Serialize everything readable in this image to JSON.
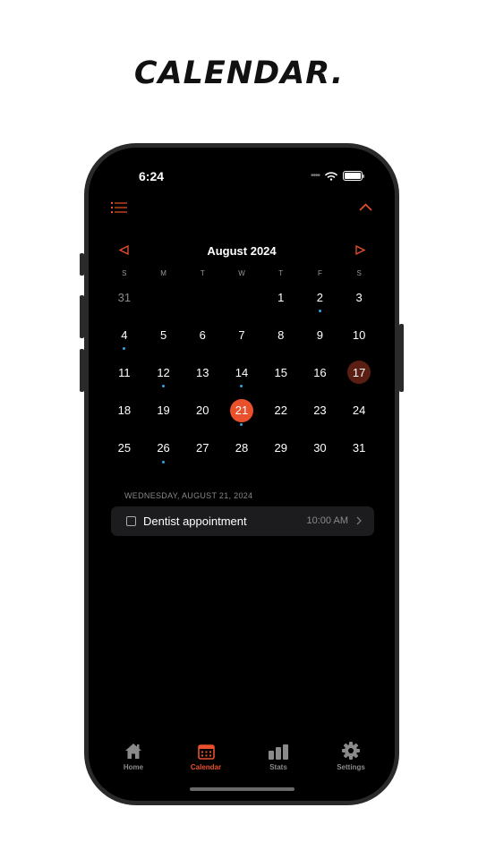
{
  "headline": "CALENDAR.",
  "status": {
    "time": "6:24"
  },
  "colors": {
    "accent": "#e8512c",
    "event_dot": "#2aa9e0",
    "today_bg": "#5a1f12"
  },
  "calendar": {
    "month_title": "August 2024",
    "weekdays": [
      "S",
      "M",
      "T",
      "W",
      "T",
      "F",
      "S"
    ],
    "weeks": [
      [
        {
          "label": "31",
          "muted": true
        },
        {
          "label": ""
        },
        {
          "label": ""
        },
        {
          "label": ""
        },
        {
          "label": "1"
        },
        {
          "label": "2",
          "dot": true
        },
        {
          "label": "3"
        }
      ],
      [
        {
          "label": "4",
          "dot": true
        },
        {
          "label": "5"
        },
        {
          "label": "6"
        },
        {
          "label": "7"
        },
        {
          "label": "8"
        },
        {
          "label": "9"
        },
        {
          "label": "10"
        }
      ],
      [
        {
          "label": "11"
        },
        {
          "label": "12",
          "dot": true
        },
        {
          "label": "13"
        },
        {
          "label": "14",
          "dot": true
        },
        {
          "label": "15"
        },
        {
          "label": "16"
        },
        {
          "label": "17",
          "today": true
        }
      ],
      [
        {
          "label": "18"
        },
        {
          "label": "19"
        },
        {
          "label": "20"
        },
        {
          "label": "21",
          "selected": true,
          "dot": true
        },
        {
          "label": "22"
        },
        {
          "label": "23"
        },
        {
          "label": "24"
        }
      ],
      [
        {
          "label": "25"
        },
        {
          "label": "26",
          "dot": true
        },
        {
          "label": "27"
        },
        {
          "label": "28"
        },
        {
          "label": "29"
        },
        {
          "label": "30"
        },
        {
          "label": "31"
        }
      ]
    ]
  },
  "agenda": {
    "date_header": "WEDNESDAY, AUGUST 21, 2024",
    "events": [
      {
        "title": "Dentist appointment",
        "time": "10:00 AM",
        "done": false
      }
    ]
  },
  "tabbar": {
    "tabs": [
      {
        "label": "Home",
        "icon": "house-icon",
        "active": false
      },
      {
        "label": "Calendar",
        "icon": "calendar-icon",
        "active": true
      },
      {
        "label": "Stats",
        "icon": "bar-chart-icon",
        "active": false
      },
      {
        "label": "Settings",
        "icon": "gear-icon",
        "active": false
      }
    ]
  }
}
